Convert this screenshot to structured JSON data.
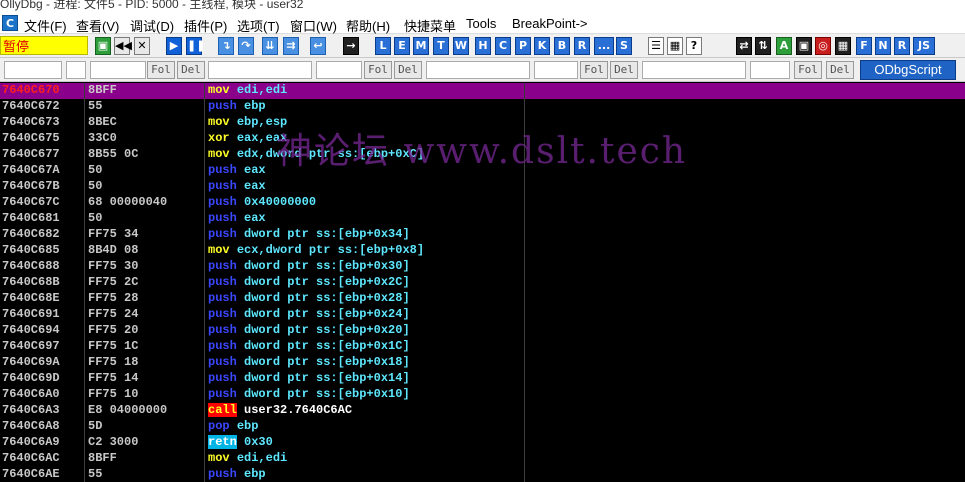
{
  "window": {
    "title": "OllyDbg - 进程: 文件5 - PID: 5000 - 主线程, 模块 - user32"
  },
  "menu": {
    "icon": "C",
    "items": [
      "文件(F)",
      "查看(V)",
      "调试(D)",
      "插件(P)",
      "选项(T)",
      "窗口(W)",
      "帮助(H)",
      "快捷菜单",
      "Tools",
      "BreakPoint->"
    ]
  },
  "toolbar": {
    "status": "暂停",
    "letters": [
      "L",
      "E",
      "M",
      "T",
      "W",
      "H",
      "C",
      "P",
      "K",
      "B",
      "R",
      "...",
      "S"
    ],
    "right_letters": [
      "F",
      "N",
      "R",
      "JS"
    ]
  },
  "filter_bar": {
    "fol_label": "Fol",
    "del_label": "Del",
    "script_button": "ODbgScript"
  },
  "watermark": {
    "text": "神论坛  www.dslt.tech"
  },
  "disasm": {
    "selected_index": 0,
    "rows": [
      {
        "addr": "7640C670",
        "hex": "8BFF",
        "mn": "mov",
        "ops": "edi,edi",
        "kind": "gen"
      },
      {
        "addr": "7640C672",
        "hex": "55",
        "mn": "push",
        "ops": "ebp",
        "kind": "push"
      },
      {
        "addr": "7640C673",
        "hex": "8BEC",
        "mn": "mov",
        "ops": "ebp,esp",
        "kind": "gen"
      },
      {
        "addr": "7640C675",
        "hex": "33C0",
        "mn": "xor",
        "ops": "eax,eax",
        "kind": "gen"
      },
      {
        "addr": "7640C677",
        "hex": "8B55 0C",
        "mn": "mov",
        "ops": "edx,dword ptr ss:[ebp+0xC]",
        "kind": "gen"
      },
      {
        "addr": "7640C67A",
        "hex": "50",
        "mn": "push",
        "ops": "eax",
        "kind": "push"
      },
      {
        "addr": "7640C67B",
        "hex": "50",
        "mn": "push",
        "ops": "eax",
        "kind": "push"
      },
      {
        "addr": "7640C67C",
        "hex": "68 00000040",
        "mn": "push",
        "ops": "0x40000000",
        "kind": "push"
      },
      {
        "addr": "7640C681",
        "hex": "50",
        "mn": "push",
        "ops": "eax",
        "kind": "push"
      },
      {
        "addr": "7640C682",
        "hex": "FF75 34",
        "mn": "push",
        "ops": "dword ptr ss:[ebp+0x34]",
        "kind": "push"
      },
      {
        "addr": "7640C685",
        "hex": "8B4D 08",
        "mn": "mov",
        "ops": "ecx,dword ptr ss:[ebp+0x8]",
        "kind": "gen"
      },
      {
        "addr": "7640C688",
        "hex": "FF75 30",
        "mn": "push",
        "ops": "dword ptr ss:[ebp+0x30]",
        "kind": "push"
      },
      {
        "addr": "7640C68B",
        "hex": "FF75 2C",
        "mn": "push",
        "ops": "dword ptr ss:[ebp+0x2C]",
        "kind": "push"
      },
      {
        "addr": "7640C68E",
        "hex": "FF75 28",
        "mn": "push",
        "ops": "dword ptr ss:[ebp+0x28]",
        "kind": "push"
      },
      {
        "addr": "7640C691",
        "hex": "FF75 24",
        "mn": "push",
        "ops": "dword ptr ss:[ebp+0x24]",
        "kind": "push"
      },
      {
        "addr": "7640C694",
        "hex": "FF75 20",
        "mn": "push",
        "ops": "dword ptr ss:[ebp+0x20]",
        "kind": "push"
      },
      {
        "addr": "7640C697",
        "hex": "FF75 1C",
        "mn": "push",
        "ops": "dword ptr ss:[ebp+0x1C]",
        "kind": "push"
      },
      {
        "addr": "7640C69A",
        "hex": "FF75 18",
        "mn": "push",
        "ops": "dword ptr ss:[ebp+0x18]",
        "kind": "push"
      },
      {
        "addr": "7640C69D",
        "hex": "FF75 14",
        "mn": "push",
        "ops": "dword ptr ss:[ebp+0x14]",
        "kind": "push"
      },
      {
        "addr": "7640C6A0",
        "hex": "FF75 10",
        "mn": "push",
        "ops": "dword ptr ss:[ebp+0x10]",
        "kind": "push"
      },
      {
        "addr": "7640C6A3",
        "hex": "E8 04000000",
        "mn": "call",
        "ops": "user32.7640C6AC",
        "kind": "call"
      },
      {
        "addr": "7640C6A8",
        "hex": "5D",
        "mn": "pop",
        "ops": "ebp",
        "kind": "pop"
      },
      {
        "addr": "7640C6A9",
        "hex": "C2 3000",
        "mn": "retn",
        "ops": "0x30",
        "kind": "retn"
      },
      {
        "addr": "7640C6AC",
        "hex": "8BFF",
        "mn": "mov",
        "ops": "edi,edi",
        "kind": "gen"
      },
      {
        "addr": "7640C6AE",
        "hex": "55",
        "mn": "push",
        "ops": "ebp",
        "kind": "push"
      }
    ]
  }
}
